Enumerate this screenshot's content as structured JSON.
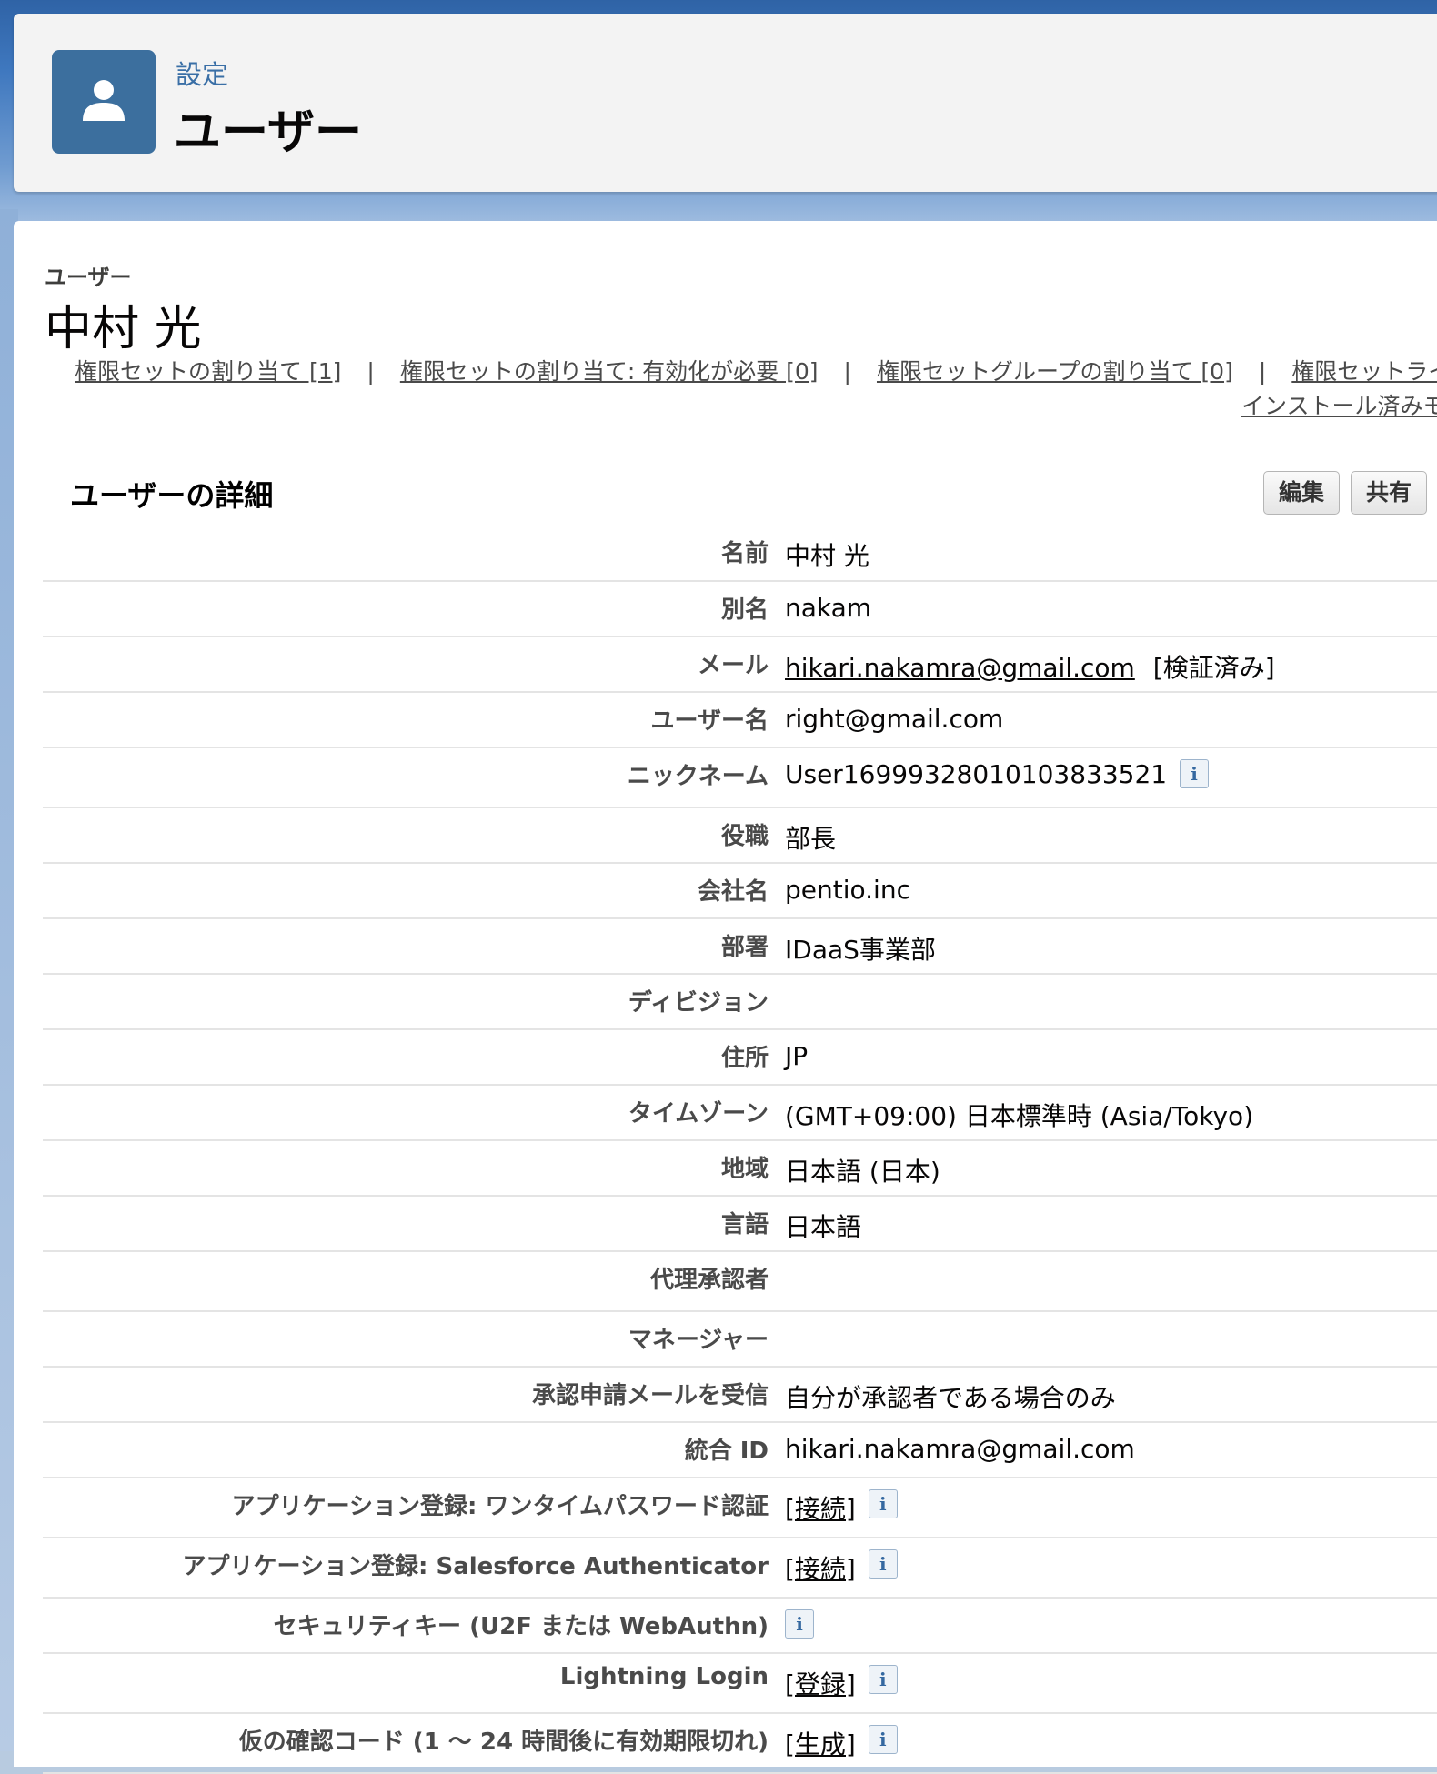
{
  "header": {
    "breadcrumb": "設定",
    "title": "ユーザー",
    "icon": "user-icon"
  },
  "record": {
    "type": "ユーザー",
    "name": "中村 光"
  },
  "related_links": [
    "権限セットの割り当て [1]",
    "権限セットの割り当て: 有効化が必要 [0]",
    "権限セットグループの割り当て [0]",
    "権限セットライ",
    "インストール済みモ"
  ],
  "separator": "|",
  "detail": {
    "title": "ユーザーの詳細",
    "edit_button": "編集",
    "share_button": "共有"
  },
  "fields": [
    {
      "label": "名前",
      "value": "中村 光"
    },
    {
      "label": "別名",
      "value": "nakam"
    },
    {
      "label": "メール",
      "link": "hikari.nakamra@gmail.com",
      "suffix": "[検証済み]"
    },
    {
      "label": "ユーザー名",
      "value": "right@gmail.com"
    },
    {
      "label": "ニックネーム",
      "value": "User16999328010103833521",
      "info": true
    },
    {
      "label": "役職",
      "value": "部長"
    },
    {
      "label": "会社名",
      "value": "pentio.inc"
    },
    {
      "label": "部署",
      "value": "IDaaS事業部"
    },
    {
      "label": "ディビジョン",
      "value": ""
    },
    {
      "label": "住所",
      "value": "JP"
    },
    {
      "label": "タイムゾーン",
      "value": "(GMT+09:00) 日本標準時 (Asia/Tokyo)"
    },
    {
      "label": "地域",
      "value": "日本語 (日本)"
    },
    {
      "label": "言語",
      "value": "日本語"
    },
    {
      "label": "代理承認者",
      "value": ""
    },
    {
      "label": "マネージャー",
      "value": ""
    },
    {
      "label": "承認申請メールを受信",
      "value": "自分が承認者である場合のみ"
    },
    {
      "label": "統合 ID",
      "value": "hikari.nakamra@gmail.com"
    },
    {
      "label": "アプリケーション登録: ワンタイムパスワード認証",
      "link": "[接続]",
      "info": true
    },
    {
      "label": "アプリケーション登録: Salesforce Authenticator",
      "link": "[接続]",
      "info": true
    },
    {
      "label": "セキュリティキー (U2F または WebAuthn)",
      "info": true
    },
    {
      "label": "Lightning Login",
      "link": "[登録]",
      "info": true
    },
    {
      "label": "仮の確認コード (1 〜 24 時間後に有効期限切れ)",
      "link": "[生成]",
      "info": true
    }
  ],
  "info_glyph": "i",
  "colors": {
    "accent": "#3c6f9e",
    "link": "#3a6fa6",
    "background": "#3f78bf"
  }
}
